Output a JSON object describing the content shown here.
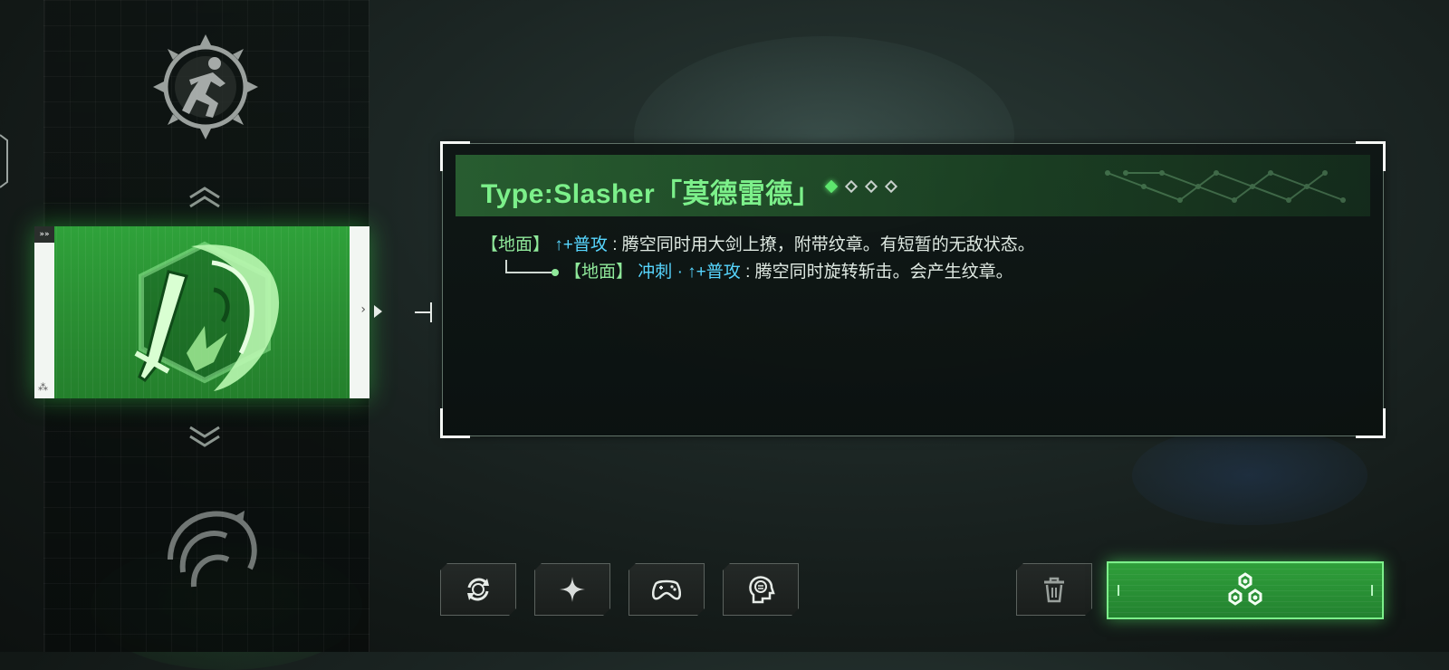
{
  "skill": {
    "title": "Type:Slasher「莫德雷德」",
    "rank": {
      "filled": 1,
      "total": 4
    }
  },
  "descriptions": [
    {
      "prefix": "【地面】",
      "command": "↑+普攻",
      "separator": ":",
      "text": "腾空同时用大剑上撩，附带纹章。有短暂的无敌状态。"
    },
    {
      "prefix": "【地面】",
      "command": "冲刺 · ↑+普攻",
      "separator": ":",
      "text": "腾空同时旋转斩击。会产生纹章。"
    }
  ],
  "selector": {
    "selected_card_icon": "sword-slash-emblem-icon",
    "prev_icon": "sprinting-figure-gear-icon",
    "next_icon": "swirl-blade-icon"
  },
  "toolbar": {
    "buttons": [
      "reset-icon",
      "sparkle-icon",
      "gamepad-icon",
      "tips-head-icon"
    ],
    "delete": "trash-icon",
    "confirm": "equip-chip-icon"
  },
  "colors": {
    "accent_green": "#7cf08a",
    "command_blue": "#57d6ff",
    "card_green": "#2fa23a"
  }
}
